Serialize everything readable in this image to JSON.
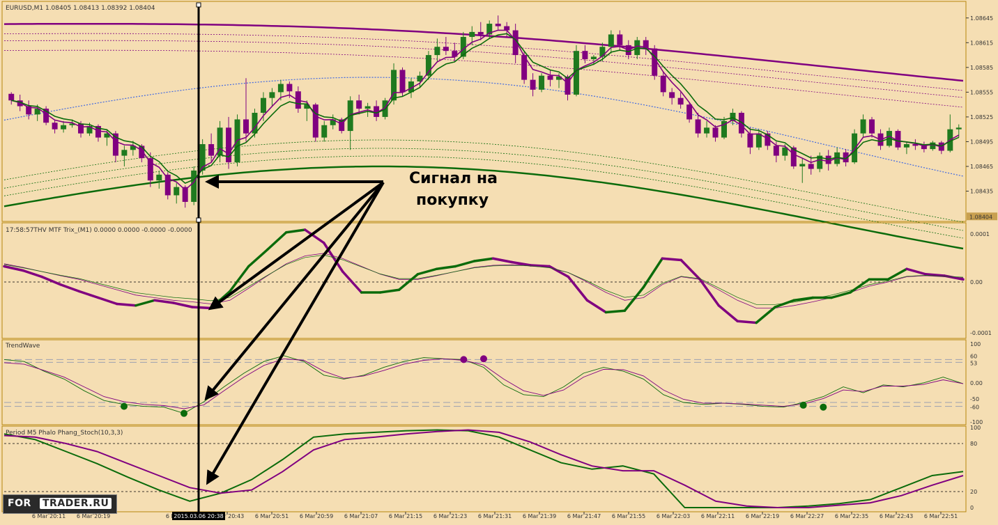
{
  "colors": {
    "background": "#f5deb3",
    "bull": "#1f7a1f",
    "bear": "#800080",
    "ema_fast": "#800080",
    "ema_slow": "#0b6b0b",
    "ma_blue": "#4169e1",
    "axis": "#b8860b",
    "arrow": "#000000",
    "level_line": "#9aa0b0"
  },
  "main_panel": {
    "header": "EURUSD,M1  1.08405 1.08413 1.08392 1.08404",
    "current_price": "1.08404",
    "price_axis": [
      "1.08645",
      "1.08615",
      "1.08585",
      "1.08555",
      "1.08525",
      "1.08495",
      "1.08465",
      "1.08435"
    ]
  },
  "trix_panel": {
    "header": "17:58:57THV MTF Trix_(M1) 0.0000 0.0000 -0.0000 -0.0000",
    "axis": [
      "0.0001",
      "0.00",
      "-0.0001"
    ]
  },
  "trend_panel": {
    "header": "TrendWave",
    "axis": [
      "100",
      "60",
      "53",
      "0.00",
      "-50",
      "-60",
      "-100"
    ]
  },
  "stoch_panel": {
    "header": "Period M5 Phalo Phang_Stoch(10,3,3)",
    "axis": [
      "100",
      "80",
      "20",
      "0"
    ]
  },
  "time_axis": [
    "6 Mar 20:11",
    "6 Mar 20:19",
    "6 Mar 20:27",
    "6 Mar 20:43",
    "6 Mar 20:51",
    "6 Mar 20:59",
    "6 Mar 21:07",
    "6 Mar 21:15",
    "6 Mar 21:23",
    "6 Mar 21:31",
    "6 Mar 21:39",
    "6 Mar 21:47",
    "6 Mar 21:55",
    "6 Mar 22:03",
    "6 Mar 22:11",
    "6 Mar 22:19",
    "6 Mar 22:27",
    "6 Mar 22:35",
    "6 Mar 22:43",
    "6 Mar 22:51"
  ],
  "time_cursor_label": "2015.03.06 20:38",
  "annotation": {
    "line1": "Сигнал на",
    "line2": "покупку"
  },
  "watermark": {
    "left": "FOR",
    "right": "TRADER.RU"
  },
  "chart_data": [
    {
      "type": "candlestick",
      "title": "EURUSD,M1",
      "ylim": [
        1.084,
        1.0866
      ],
      "candles": [
        [
          1.08553,
          1.08555,
          1.0854,
          1.08545
        ],
        [
          1.08545,
          1.08552,
          1.08532,
          1.08538
        ],
        [
          1.08538,
          1.08545,
          1.08522,
          1.08528
        ],
        [
          1.08528,
          1.0854,
          1.0852,
          1.08535
        ],
        [
          1.08535,
          1.08538,
          1.08515,
          1.08518
        ],
        [
          1.08518,
          1.08522,
          1.08505,
          1.0851
        ],
        [
          1.0851,
          1.0852,
          1.08506,
          1.08515
        ],
        [
          1.08515,
          1.08522,
          1.08512,
          1.08517
        ],
        [
          1.08517,
          1.0852,
          1.085,
          1.08505
        ],
        [
          1.08505,
          1.08518,
          1.08502,
          1.08514
        ],
        [
          1.08514,
          1.08516,
          1.08495,
          1.085
        ],
        [
          1.085,
          1.0851,
          1.0849,
          1.08505
        ],
        [
          1.08505,
          1.08508,
          1.0847,
          1.08478
        ],
        [
          1.08478,
          1.0849,
          1.08465,
          1.08485
        ],
        [
          1.08485,
          1.08496,
          1.08478,
          1.0849
        ],
        [
          1.0849,
          1.08492,
          1.0847,
          1.08475
        ],
        [
          1.08475,
          1.08482,
          1.0844,
          1.08448
        ],
        [
          1.08448,
          1.0846,
          1.08438,
          1.08455
        ],
        [
          1.08455,
          1.08458,
          1.08425,
          1.0843
        ],
        [
          1.0843,
          1.08445,
          1.0842,
          1.0844
        ],
        [
          1.0844,
          1.08442,
          1.08415,
          1.08422
        ],
        [
          1.08422,
          1.08465,
          1.08418,
          1.0846
        ],
        [
          1.0846,
          1.08498,
          1.08455,
          1.08492
        ],
        [
          1.08492,
          1.08505,
          1.0847,
          1.08478
        ],
        [
          1.08478,
          1.0852,
          1.0847,
          1.08512
        ],
        [
          1.08512,
          1.08525,
          1.08462,
          1.0847
        ],
        [
          1.0847,
          1.08528,
          1.08465,
          1.08522
        ],
        [
          1.08522,
          1.08572,
          1.08495,
          1.08505
        ],
        [
          1.08505,
          1.08535,
          1.085,
          1.0853
        ],
        [
          1.0853,
          1.08555,
          1.0852,
          1.08548
        ],
        [
          1.08548,
          1.0856,
          1.08538,
          1.08555
        ],
        [
          1.08555,
          1.0857,
          1.08545,
          1.08565
        ],
        [
          1.08565,
          1.08568,
          1.08548,
          1.08556
        ],
        [
          1.08556,
          1.08562,
          1.0853,
          1.08535
        ],
        [
          1.08535,
          1.08545,
          1.0852,
          1.0854
        ],
        [
          1.0854,
          1.08542,
          1.08495,
          1.085
        ],
        [
          1.085,
          1.0852,
          1.08495,
          1.08515
        ],
        [
          1.08515,
          1.08528,
          1.0851,
          1.08522
        ],
        [
          1.08522,
          1.08524,
          1.08505,
          1.08508
        ],
        [
          1.08508,
          1.0855,
          1.08485,
          1.08545
        ],
        [
          1.08545,
          1.08552,
          1.08528,
          1.08535
        ],
        [
          1.08535,
          1.08542,
          1.08525,
          1.08538
        ],
        [
          1.08538,
          1.08545,
          1.0852,
          1.08525
        ],
        [
          1.08525,
          1.08548,
          1.08522,
          1.08545
        ],
        [
          1.08545,
          1.0859,
          1.0854,
          1.08582
        ],
        [
          1.08582,
          1.08585,
          1.0855,
          1.08555
        ],
        [
          1.08555,
          1.08572,
          1.08548,
          1.08568
        ],
        [
          1.08568,
          1.0858,
          1.0856,
          1.08575
        ],
        [
          1.08575,
          1.08605,
          1.0857,
          1.086
        ],
        [
          1.086,
          1.0862,
          1.08592,
          1.0861
        ],
        [
          1.0861,
          1.08622,
          1.086,
          1.08605
        ],
        [
          1.08605,
          1.08615,
          1.08592,
          1.08598
        ],
        [
          1.08598,
          1.08628,
          1.08595,
          1.08622
        ],
        [
          1.08622,
          1.08635,
          1.08612,
          1.08628
        ],
        [
          1.08628,
          1.0864,
          1.08618,
          1.08625
        ],
        [
          1.08625,
          1.08642,
          1.0862,
          1.08638
        ],
        [
          1.08638,
          1.08648,
          1.0863,
          1.08635
        ],
        [
          1.08635,
          1.0864,
          1.08622,
          1.0863
        ],
        [
          1.0863,
          1.08638,
          1.0859,
          1.086
        ],
        [
          1.086,
          1.08605,
          1.08565,
          1.0857
        ],
        [
          1.0857,
          1.08578,
          1.0855,
          1.08558
        ],
        [
          1.08558,
          1.08578,
          1.08555,
          1.08575
        ],
        [
          1.08575,
          1.08582,
          1.08562,
          1.0857
        ],
        [
          1.0857,
          1.08578,
          1.0856,
          1.08574
        ],
        [
          1.08574,
          1.08576,
          1.08545,
          1.08552
        ],
        [
          1.08552,
          1.08612,
          1.0855,
          1.08605
        ],
        [
          1.08605,
          1.08612,
          1.0859,
          1.08595
        ],
        [
          1.08595,
          1.086,
          1.08588,
          1.08598
        ],
        [
          1.08598,
          1.08615,
          1.08592,
          1.0861
        ],
        [
          1.0861,
          1.0863,
          1.08602,
          1.08625
        ],
        [
          1.08625,
          1.0863,
          1.08605,
          1.08612
        ],
        [
          1.08612,
          1.08618,
          1.08595,
          1.086
        ],
        [
          1.086,
          1.08622,
          1.08595,
          1.08618
        ],
        [
          1.08618,
          1.08622,
          1.086,
          1.08608
        ],
        [
          1.08608,
          1.08612,
          1.0857,
          1.08575
        ],
        [
          1.08575,
          1.0858,
          1.0855,
          1.08555
        ],
        [
          1.08555,
          1.0856,
          1.0854,
          1.08548
        ],
        [
          1.08548,
          1.08555,
          1.08535,
          1.0854
        ],
        [
          1.0854,
          1.08542,
          1.08518,
          1.08522
        ],
        [
          1.08522,
          1.0853,
          1.085,
          1.08505
        ],
        [
          1.08505,
          1.0852,
          1.085,
          1.08512
        ],
        [
          1.08512,
          1.08515,
          1.08495,
          1.085
        ],
        [
          1.085,
          1.08525,
          1.08498,
          1.0852
        ],
        [
          1.0852,
          1.08535,
          1.08515,
          1.0853
        ],
        [
          1.0853,
          1.08532,
          1.085,
          1.08505
        ],
        [
          1.08505,
          1.08512,
          1.0848,
          1.08488
        ],
        [
          1.08488,
          1.0851,
          1.08485,
          1.08505
        ],
        [
          1.08505,
          1.08508,
          1.08485,
          1.0849
        ],
        [
          1.0849,
          1.08495,
          1.0847,
          1.08478
        ],
        [
          1.08478,
          1.08492,
          1.08472,
          1.08488
        ],
        [
          1.08488,
          1.0849,
          1.08462,
          1.08465
        ],
        [
          1.08465,
          1.08475,
          1.08445,
          1.08468
        ],
        [
          1.08468,
          1.08478,
          1.08455,
          1.08462
        ],
        [
          1.08462,
          1.08482,
          1.08458,
          1.08478
        ],
        [
          1.08478,
          1.08485,
          1.0846,
          1.08468
        ],
        [
          1.08468,
          1.08488,
          1.08465,
          1.08482
        ],
        [
          1.08482,
          1.08486,
          1.08465,
          1.0847
        ],
        [
          1.0847,
          1.0851,
          1.08468,
          1.08505
        ],
        [
          1.08505,
          1.08528,
          1.085,
          1.08522
        ],
        [
          1.08522,
          1.08525,
          1.085,
          1.08505
        ],
        [
          1.08505,
          1.0851,
          1.08485,
          1.0849
        ],
        [
          1.0849,
          1.08512,
          1.08488,
          1.08508
        ],
        [
          1.08508,
          1.0851,
          1.08485,
          1.08488
        ],
        [
          1.08488,
          1.08495,
          1.0848,
          1.08492
        ],
        [
          1.08492,
          1.08498,
          1.08485,
          1.0849
        ],
        [
          1.0849,
          1.08495,
          1.08482,
          1.08486
        ],
        [
          1.08486,
          1.08496,
          1.08484,
          1.08494
        ],
        [
          1.08494,
          1.08496,
          1.0848,
          1.08484
        ],
        [
          1.08484,
          1.08528,
          1.08482,
          1.0851
        ],
        [
          1.0851,
          1.08516,
          1.085,
          1.08512
        ]
      ]
    },
    {
      "type": "line",
      "title": "17:58:57THV MTF Trix_(M1)",
      "ylim": [
        -0.0001,
        0.0001
      ],
      "series": [
        {
          "values": [
            0.3,
            0.22,
            0.1,
            -0.05,
            -0.18,
            -0.3,
            -0.42,
            -0.45,
            -0.35,
            -0.4,
            -0.48,
            -0.5,
            -0.18,
            0.3,
            0.62,
            0.95,
            1.0,
            0.75,
            0.2,
            -0.2,
            -0.2,
            -0.15,
            0.15,
            0.25,
            0.3,
            0.4,
            0.45,
            0.38,
            0.32,
            0.3,
            0.1,
            -0.35,
            -0.58,
            -0.55,
            -0.1,
            0.45,
            0.42,
            0.05,
            -0.45,
            -0.75,
            -0.78,
            -0.48,
            -0.35,
            -0.3,
            -0.3,
            -0.2,
            0.05,
            0.05,
            0.25,
            0.15,
            0.12,
            0.05
          ]
        },
        {
          "values": [
            0.35,
            0.28,
            0.2,
            0.12,
            0.05,
            -0.05,
            -0.15,
            -0.25,
            -0.3,
            -0.35,
            -0.38,
            -0.42,
            -0.35,
            -0.12,
            0.12,
            0.35,
            0.5,
            0.55,
            0.45,
            0.3,
            0.15,
            0.05,
            0.05,
            0.12,
            0.2,
            0.28,
            0.32,
            0.33,
            0.32,
            0.28,
            0.18,
            0.0,
            -0.2,
            -0.35,
            -0.3,
            -0.05,
            0.1,
            0.05,
            -0.15,
            -0.35,
            -0.5,
            -0.5,
            -0.45,
            -0.38,
            -0.3,
            -0.2,
            -0.08,
            0.0,
            0.1,
            0.12,
            0.1,
            0.08
          ]
        }
      ]
    },
    {
      "type": "line",
      "title": "TrendWave",
      "ylim": [
        -100,
        100
      ],
      "series": [
        {
          "values": [
            60,
            55,
            30,
            10,
            -20,
            -45,
            -55,
            -60,
            -62,
            -78,
            -48,
            -10,
            25,
            55,
            70,
            55,
            20,
            10,
            20,
            40,
            55,
            65,
            62,
            60,
            40,
            -5,
            -30,
            -35,
            -10,
            25,
            40,
            30,
            10,
            -30,
            -50,
            -55,
            -52,
            -55,
            -60,
            -62,
            -50,
            -35,
            -10,
            -25,
            -5,
            -10,
            0,
            15,
            -2
          ]
        },
        {
          "values": [
            52,
            48,
            32,
            15,
            -10,
            -35,
            -48,
            -55,
            -58,
            -66,
            -56,
            -20,
            15,
            45,
            62,
            58,
            30,
            12,
            18,
            32,
            48,
            58,
            62,
            58,
            46,
            10,
            -20,
            -32,
            -18,
            15,
            35,
            34,
            18,
            -18,
            -42,
            -52,
            -52,
            -54,
            -57,
            -60,
            -54,
            -40,
            -18,
            -22,
            -8,
            -8,
            -4,
            8,
            -2
          ]
        }
      ],
      "markers": [
        {
          "i": 6,
          "value": -60,
          "color": "bull"
        },
        {
          "i": 9,
          "value": -78,
          "color": "bull"
        },
        {
          "i": 23,
          "value": 60,
          "color": "bear"
        },
        {
          "i": 24,
          "value": 62,
          "color": "bear"
        },
        {
          "i": 40,
          "value": -57,
          "color": "bull"
        },
        {
          "i": 41,
          "value": -62,
          "color": "bull"
        }
      ]
    },
    {
      "type": "line",
      "title": "Period M5 Phalo Phang_Stoch(10,3,3)",
      "ylim": [
        0,
        100
      ],
      "series": [
        {
          "values": [
            92,
            85,
            70,
            55,
            38,
            22,
            8,
            18,
            35,
            60,
            88,
            92,
            94,
            96,
            97,
            96,
            88,
            72,
            56,
            48,
            52,
            42,
            0,
            0,
            0,
            0,
            2,
            5,
            10,
            25,
            40,
            45
          ]
        },
        {
          "values": [
            90,
            88,
            80,
            70,
            55,
            40,
            25,
            18,
            22,
            45,
            72,
            85,
            88,
            92,
            95,
            97,
            94,
            82,
            66,
            52,
            46,
            46,
            28,
            8,
            2,
            0,
            0,
            3,
            6,
            15,
            28,
            40
          ]
        }
      ]
    }
  ]
}
